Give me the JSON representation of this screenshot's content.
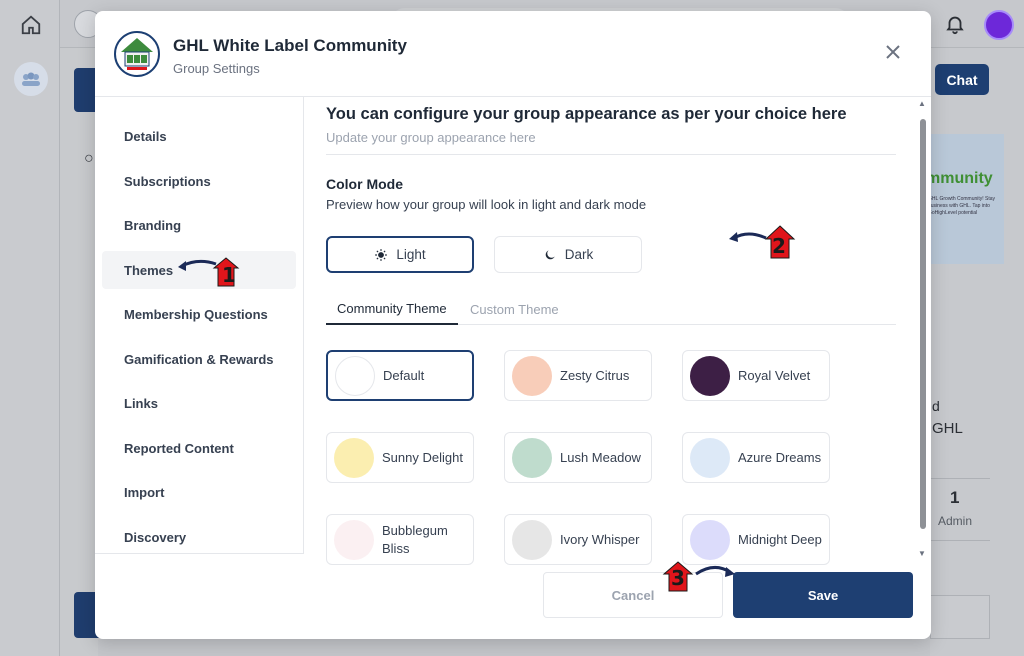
{
  "background": {
    "chat_label": "Chat",
    "banner_title": "mmunity",
    "banner_text": "GHL Growth Community! Stay business with GHL. Tap into GoHighLevel potential",
    "side_text_1": "d",
    "side_text_2": "GHL",
    "member_count": "1",
    "member_role": "Admin"
  },
  "modal": {
    "title": "GHL White Label Community",
    "subtitle": "Group Settings"
  },
  "nav": {
    "items": [
      {
        "label": "Details"
      },
      {
        "label": "Subscriptions"
      },
      {
        "label": "Branding"
      },
      {
        "label": "Themes",
        "active": true
      },
      {
        "label": "Membership Questions"
      },
      {
        "label": "Gamification & Rewards"
      },
      {
        "label": "Links"
      },
      {
        "label": "Reported Content"
      },
      {
        "label": "Import"
      },
      {
        "label": "Discovery"
      }
    ]
  },
  "content": {
    "heading": "You can configure your group appearance as per your choice here",
    "subheading": "Update your group appearance here",
    "color_mode": {
      "title": "Color Mode",
      "description": "Preview how your group will look in light and dark mode",
      "light_label": "Light",
      "dark_label": "Dark",
      "selected": "Light"
    },
    "tabs": [
      {
        "label": "Community Theme",
        "active": true
      },
      {
        "label": "Custom Theme",
        "active": false
      }
    ],
    "themes": [
      {
        "name": "Default",
        "color": "#ffffff",
        "selected": true
      },
      {
        "name": "Zesty Citrus",
        "color": "#f8cdb9"
      },
      {
        "name": "Royal Velvet",
        "color": "#3d1f45"
      },
      {
        "name": "Sunny Delight",
        "color": "#fbeeb0"
      },
      {
        "name": "Lush Meadow",
        "color": "#bfdccd"
      },
      {
        "name": "Azure Dreams",
        "color": "#dde9f7"
      },
      {
        "name": "Bubblegum Bliss",
        "color": "#fbf0f2"
      },
      {
        "name": "Ivory Whisper",
        "color": "#e6e6e6"
      },
      {
        "name": "Midnight Deep",
        "color": "#dcdcfb"
      }
    ]
  },
  "footer": {
    "cancel_label": "Cancel",
    "save_label": "Save"
  },
  "annotations": [
    "1",
    "2",
    "3"
  ],
  "colors": {
    "primary": "#1e3f72",
    "callout_red": "#e0151b",
    "callout_arrow": "#1b2a57"
  }
}
